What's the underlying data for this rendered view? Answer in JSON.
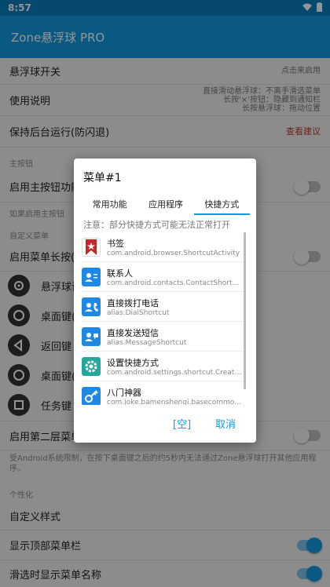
{
  "status": {
    "time": "8:57"
  },
  "app": {
    "title": "Zone悬浮球 PRO"
  },
  "settings": {
    "float_switch": {
      "label": "悬浮球开关",
      "hint": "点击来启用"
    },
    "instructions": {
      "label": "使用说明",
      "hint_lines": [
        "直接滑动悬浮球：不离手滑选菜单",
        "长按'×'按钮：隐藏到通知栏",
        "长按悬浮球：拖动位置"
      ]
    },
    "keep_alive": {
      "label": "保持后台运行(防闪退)",
      "hint": "查看建议"
    },
    "section_main": "主按钮",
    "enable_main": {
      "label": "启用主按钮功能"
    },
    "main_note": "如果启用主按钮",
    "section_menu": "自定义菜单",
    "menu_long_press": {
      "label": "启用菜单长按("
    },
    "menu_items": [
      "悬浮球设",
      "桌面键(",
      "返回键",
      "桌面键(",
      "任务键"
    ],
    "enable_second": {
      "label": "启用第二层菜单"
    },
    "restriction_note": "受Android系统限制，在按下桌面键之后的约5秒内无法通过Zone悬浮球打开其他应用程序。",
    "section_personal": "个性化",
    "custom_style": {
      "label": "自定义样式"
    },
    "top_menu_bar": {
      "label": "显示顶部菜单栏",
      "on": true
    },
    "show_menu_name": {
      "label": "滑选时显示菜单名称",
      "on": true
    }
  },
  "dialog": {
    "title": "菜单#1",
    "tabs": [
      "常用功能",
      "应用程序",
      "快捷方式"
    ],
    "active_tab": 2,
    "notice": "注意：部分快捷方式可能无法正常打开",
    "shortcuts": [
      {
        "name": "书签",
        "sub": "com.android.browser.ShortcutActivity",
        "icon": "bookmark-icon",
        "color": "#c62828"
      },
      {
        "name": "联系人",
        "sub": "com.android.contacts.ContactShortcut",
        "icon": "contacts-icon",
        "color": "#1e88e5"
      },
      {
        "name": "直接拨打电话",
        "sub": "alias.DialShortcut",
        "icon": "phone-contact-icon",
        "color": "#1e88e5"
      },
      {
        "name": "直接发送短信",
        "sub": "alias.MessageShortcut",
        "icon": "message-contact-icon",
        "color": "#1e88e5"
      },
      {
        "name": "设置快捷方式",
        "sub": "com.android.settings.shortcut.CreateSh",
        "icon": "settings-gear-icon",
        "color": "#26a69a"
      },
      {
        "name": "八门神器",
        "sub": "com.joke.bamenshengi.basecommons.u",
        "icon": "key-icon",
        "color": "#1e88e5"
      }
    ],
    "empty_label": "[空]",
    "cancel_label": "取消"
  }
}
